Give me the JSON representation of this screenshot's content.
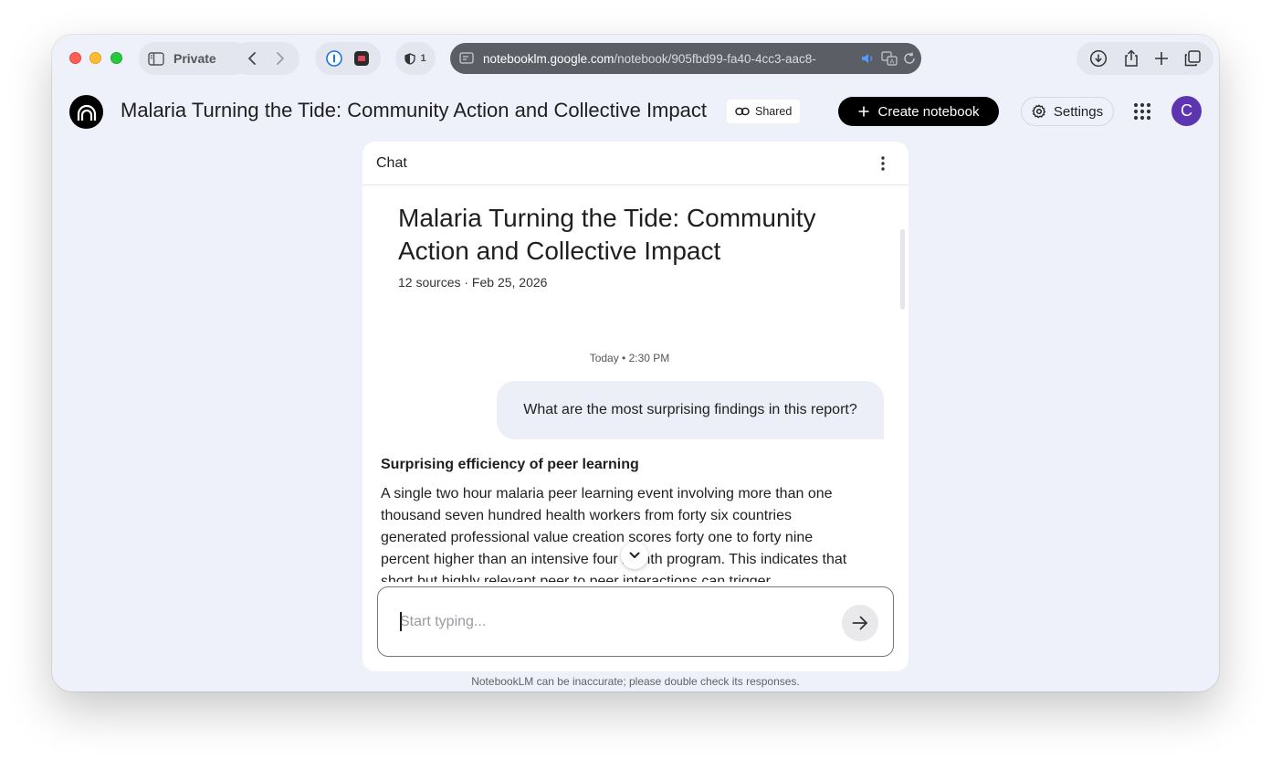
{
  "browser": {
    "private_label": "Private",
    "shield_count": "1",
    "url_host": "notebooklm.google.com",
    "url_path": "/notebook/905fbd99-fa40-4cc3-aac8-"
  },
  "header": {
    "notebook_title": "Malaria Turning the Tide: Community Action and Collective Impact",
    "shared_label": "Shared",
    "create_label": "Create notebook",
    "settings_label": "Settings",
    "avatar_initial": "C"
  },
  "chat": {
    "panel_title": "Chat",
    "conversation_title": "Malaria Turning the Tide: Community Action and Collective Impact",
    "meta": "12 sources · Feb 25, 2026",
    "timestamp": "Today • 2:30 PM",
    "user_message": "What are the most surprising findings in this report?",
    "response_heading": "Surprising efficiency of peer learning",
    "response_body": "A single two hour malaria peer learning event involving more than one thousand seven hundred health workers from forty six countries generated professional value creation scores forty one to forty nine percent higher than an intensive four month program. This indicates that short but highly relevant peer to peer interactions can trigger",
    "input_placeholder": "Start typing...",
    "disclaimer": "NotebookLM can be inaccurate; please double check its responses."
  },
  "colors": {
    "window_bg": "#eef0fa",
    "avatar": "#5e35b1",
    "user_bubble": "#eceef8"
  }
}
